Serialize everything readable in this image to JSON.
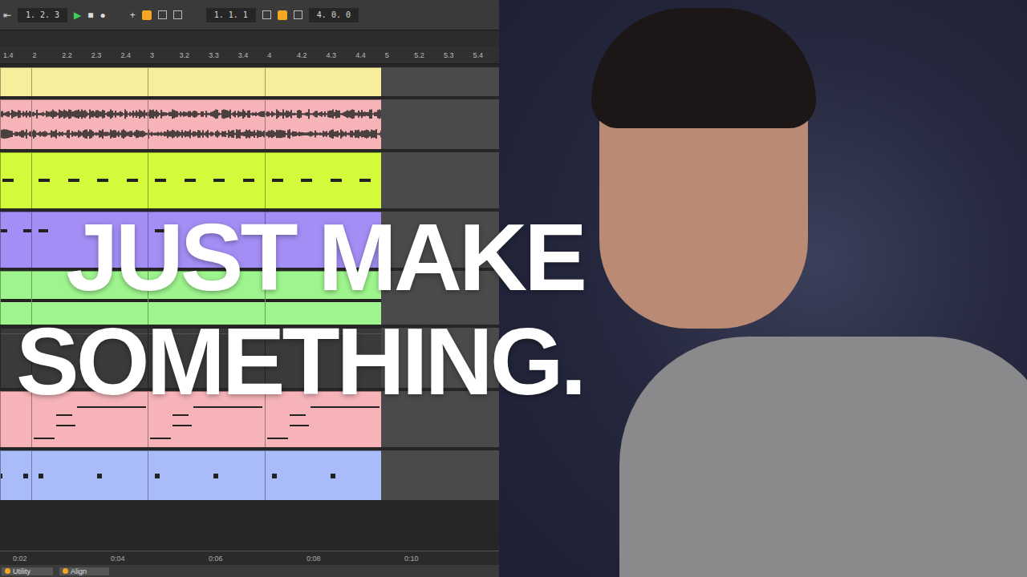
{
  "toolbar": {
    "left_glyph": "⇤",
    "position": "1. 2. 3",
    "play": "▶",
    "stop": "■",
    "record": "●",
    "add": "+",
    "loop_start": "1. 1. 1",
    "loop_length": "4. 0. 0"
  },
  "ruler": [
    "1.4",
    "2",
    "2.2",
    "2.3",
    "2.4",
    "3",
    "3.2",
    "3.3",
    "3.4",
    "4",
    "4.2",
    "4.3",
    "4.4",
    "5",
    "5.2",
    "5.3",
    "5.4"
  ],
  "tracks": [
    {
      "kind": "empty",
      "color": "#f6ee9a"
    },
    {
      "kind": "audio",
      "color": "#f6b4b8"
    },
    {
      "kind": "dashes",
      "color": "#d4fa3c"
    },
    {
      "kind": "sparse",
      "color": "#a48ef5"
    },
    {
      "kind": "line",
      "color": "#9ef58e"
    },
    {
      "kind": "blank",
      "color": "#3a3a3a"
    },
    {
      "kind": "melody",
      "color": "#f6b4b8"
    },
    {
      "kind": "dots",
      "color": "#a9bcf9"
    }
  ],
  "timeline": [
    "0:02",
    "0:04",
    "0:06",
    "0:08",
    "0:10"
  ],
  "devices": [
    "Utility",
    "Align"
  ],
  "headline": [
    "JUST MAKE",
    "SOMETHING."
  ]
}
